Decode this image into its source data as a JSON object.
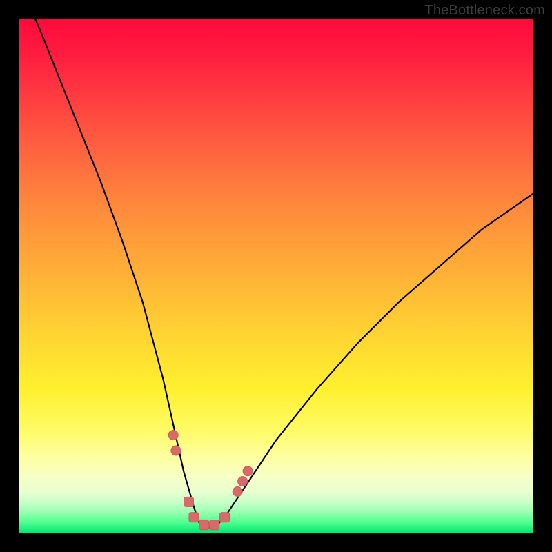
{
  "watermark": "TheBottleneck.com",
  "colors": {
    "frame": "#000000",
    "curve": "#000000",
    "markers_fill": "#d86a6a",
    "markers_stroke": "#c95a5a",
    "gradient_top": "#ff0a3c",
    "gradient_bottom": "#00e874"
  },
  "chart_data": {
    "type": "line",
    "title": "",
    "xlabel": "",
    "ylabel": "",
    "xlim": [
      0,
      100
    ],
    "ylim": [
      0,
      100
    ],
    "grid": false,
    "legend": false,
    "series": [
      {
        "name": "bottleneck-curve",
        "x": [
          0,
          4,
          8,
          12,
          16,
          20,
          24,
          28,
          30,
          32,
          34,
          35,
          36,
          38,
          40,
          44,
          50,
          58,
          66,
          74,
          82,
          90,
          100
        ],
        "values": [
          107,
          98,
          88,
          78,
          68,
          57,
          45,
          30,
          21,
          12,
          5,
          2,
          1,
          1,
          3,
          9,
          18,
          28,
          37,
          45,
          52,
          59,
          66
        ]
      }
    ],
    "annotations": [
      {
        "type": "marker-cluster",
        "approx_x": 30,
        "approx_y": 19,
        "shape": "round"
      },
      {
        "type": "marker-cluster",
        "approx_x": 30.5,
        "approx_y": 16,
        "shape": "round"
      },
      {
        "type": "marker-cluster",
        "approx_x": 33,
        "approx_y": 6,
        "shape": "square"
      },
      {
        "type": "marker-cluster",
        "approx_x": 34,
        "approx_y": 3,
        "shape": "square"
      },
      {
        "type": "marker-cluster",
        "approx_x": 36,
        "approx_y": 1.5,
        "shape": "square"
      },
      {
        "type": "marker-cluster",
        "approx_x": 38,
        "approx_y": 1.5,
        "shape": "square"
      },
      {
        "type": "marker-cluster",
        "approx_x": 40,
        "approx_y": 3,
        "shape": "square"
      },
      {
        "type": "marker-cluster",
        "approx_x": 42.5,
        "approx_y": 8,
        "shape": "round"
      },
      {
        "type": "marker-cluster",
        "approx_x": 43.5,
        "approx_y": 10,
        "shape": "round"
      },
      {
        "type": "marker-cluster",
        "approx_x": 44.5,
        "approx_y": 12,
        "shape": "round"
      }
    ]
  }
}
